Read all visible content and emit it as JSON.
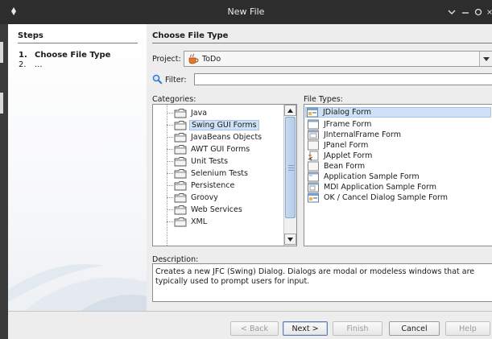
{
  "window": {
    "title": "New File"
  },
  "steps": {
    "title": "Steps",
    "items": [
      {
        "num": "1.",
        "label": "Choose File Type"
      },
      {
        "num": "2.",
        "label": "..."
      }
    ]
  },
  "main": {
    "title": "Choose File Type",
    "project_label": "Project:",
    "project_value": "ToDo",
    "filter_label": "Filter:",
    "filter_value": "",
    "categories_label": "Categories:",
    "file_types_label": "File Types:",
    "categories": [
      "Java",
      "Swing GUI Forms",
      "JavaBeans Objects",
      "AWT GUI Forms",
      "Unit Tests",
      "Selenium Tests",
      "Persistence",
      "Groovy",
      "Web Services",
      "XML"
    ],
    "selected_category": "Swing GUI Forms",
    "file_types": [
      "JDialog Form",
      "JFrame Form",
      "JInternalFrame Form",
      "JPanel Form",
      "JApplet Form",
      "Bean Form",
      "Application Sample Form",
      "MDI Application Sample Form",
      "OK / Cancel Dialog Sample Form"
    ],
    "selected_file_type": "JDialog Form",
    "description_label": "Description:",
    "description": "Creates a new JFC (Swing) Dialog. Dialogs are modal or modeless windows that are typically used to prompt users for input."
  },
  "buttons": {
    "back": "< Back",
    "next": "Next >",
    "finish": "Finish",
    "cancel": "Cancel",
    "help": "Help"
  },
  "colors": {
    "selection": "#cfe1f6",
    "titlebar": "#2d2d2d",
    "dialog_bg": "#ededed"
  }
}
